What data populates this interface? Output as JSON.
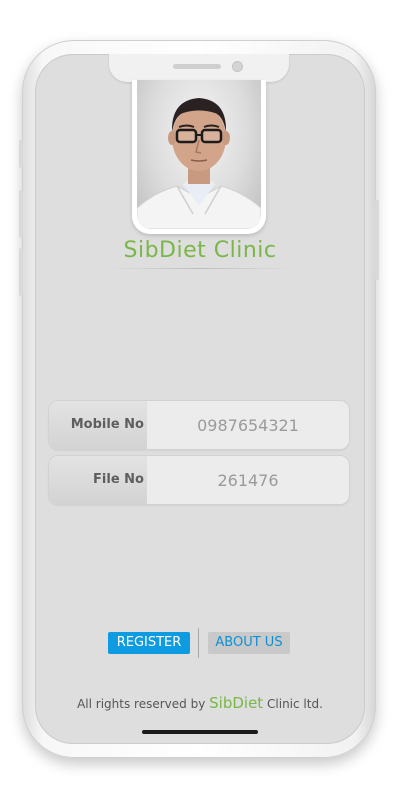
{
  "app": {
    "title": "SibDiet Clinic",
    "accent_color": "#7ab648"
  },
  "profile": {
    "photo_icon": "doctor-portrait"
  },
  "form": {
    "mobile_label": "Mobile No",
    "mobile_value": "0987654321",
    "file_label": "File No",
    "file_value": "261476"
  },
  "actions": {
    "register_label": "REGISTER",
    "register_color": "#0e9be0",
    "about_label": "ABOUT US"
  },
  "footer": {
    "prefix": "All rights reserved by",
    "brand": "SibDiet",
    "suffix": "Clinic ltd."
  }
}
